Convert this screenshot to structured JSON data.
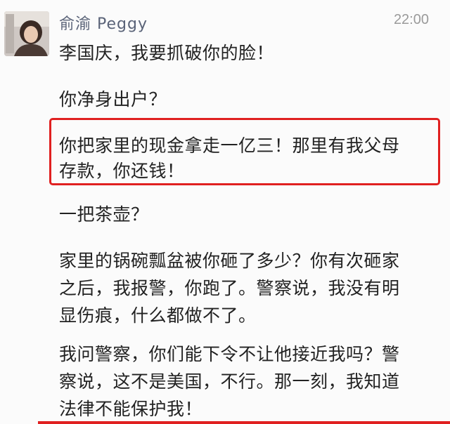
{
  "post": {
    "sender_name": "俞渝 Peggy",
    "timestamp": "22:00",
    "avatar_icon": "profile-photo",
    "highlight_color": "#e02020",
    "messages": [
      "李国庆，我要抓破你的脸！",
      "你净身出户？",
      "你把家里的现金拿走一亿三！那里有我父母",
      "存款，你还钱！",
      "一把茶壶？",
      "家里的锅碗瓢盆被你砸了多少？你有次砸家",
      "之后，我报警，你跑了。警察说，我没有明",
      "显伤痕，什么都做不了。",
      "我问警察，你们能下令不让他接近我吗？警",
      "察说，这不是美国，不行。那一刻，我知道",
      "法律不能保护我！"
    ]
  }
}
